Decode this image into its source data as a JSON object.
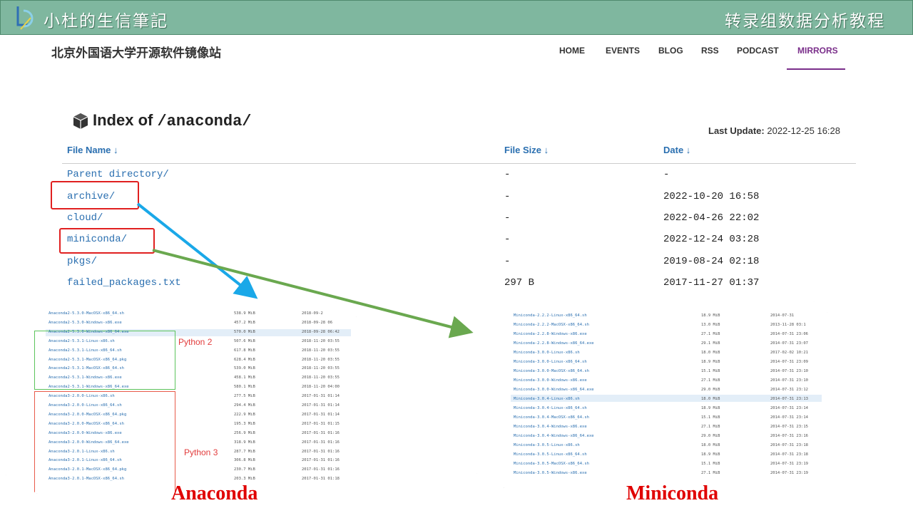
{
  "banner": {
    "left_title": "小杜的生信筆記",
    "right_title": "转录组数据分析教程"
  },
  "site": {
    "name": "北京外国语大学开源软件镜像站",
    "nav": [
      "HOME",
      "EVENTS",
      "BLOG",
      "RSS",
      "PODCAST",
      "MIRRORS"
    ],
    "active_nav": "MIRRORS"
  },
  "index": {
    "title_prefix": "Index of",
    "path": "/anaconda/",
    "last_update_label": "Last Update:",
    "last_update_value": "2022-12-25 16:28",
    "headers": {
      "name": "File Name ↓",
      "size": "File Size ↓",
      "date": "Date ↓"
    },
    "rows": [
      {
        "name": "Parent directory/",
        "size": "-",
        "date": "-"
      },
      {
        "name": "archive/",
        "size": "-",
        "date": "2022-10-20 16:58"
      },
      {
        "name": "cloud/",
        "size": "-",
        "date": "2022-04-26 22:02"
      },
      {
        "name": "miniconda/",
        "size": "-",
        "date": "2022-12-24 03:28"
      },
      {
        "name": "pkgs/",
        "size": "-",
        "date": "2019-08-24 02:18"
      },
      {
        "name": "failed_packages.txt",
        "size": "297 B",
        "date": "2017-11-27 01:37"
      }
    ]
  },
  "anaconda_shot": {
    "caption": "Anaconda",
    "label_py2": "Python 2",
    "label_py3": "Python 3",
    "rows": [
      {
        "name": "Anaconda2-5.3.0-MacOSX-x86_64.sh",
        "size": "538.9 MiB",
        "date": "2018-09-2"
      },
      {
        "name": "Anaconda2-5.3.0-Windows-x86.exe",
        "size": "457.2 MiB",
        "date": "2018-09-28 06"
      },
      {
        "name": "Anaconda2-5.3.0-Windows-x86_64.exe",
        "size": "570.0 MiB",
        "date": "2018-09-28 06:42"
      },
      {
        "name": "Anaconda2-5.3.1-Linux-x86.sh",
        "size": "507.6 MiB",
        "date": "2018-11-20 03:55"
      },
      {
        "name": "Anaconda2-5.3.1-Linux-x86_64.sh",
        "size": "617.8 MiB",
        "date": "2018-11-20 03:55"
      },
      {
        "name": "Anaconda2-5.3.1-MacOSX-x86_64.pkg",
        "size": "628.4 MiB",
        "date": "2018-11-20 03:55"
      },
      {
        "name": "Anaconda2-5.3.1-MacOSX-x86_64.sh",
        "size": "539.0 MiB",
        "date": "2018-11-20 03:55"
      },
      {
        "name": "Anaconda2-5.3.1-Windows-x86.exe",
        "size": "458.1 MiB",
        "date": "2018-11-20 03:55"
      },
      {
        "name": "Anaconda2-5.3.1-Windows-x86_64.exe",
        "size": "580.1 MiB",
        "date": "2018-11-20 04:00"
      },
      {
        "name": "Anaconda3-2.0.0-Linux-x86.sh",
        "size": "277.5 MiB",
        "date": "2017-01-31 01:14"
      },
      {
        "name": "Anaconda3-2.0.0-Linux-x86_64.sh",
        "size": "294.4 MiB",
        "date": "2017-01-31 01:14"
      },
      {
        "name": "Anaconda3-2.0.0-MacOSX-x86_64.pkg",
        "size": "222.9 MiB",
        "date": "2017-01-31 01:14"
      },
      {
        "name": "Anaconda3-2.0.0-MacOSX-x86_64.sh",
        "size": "195.3 MiB",
        "date": "2017-01-31 01:15"
      },
      {
        "name": "Anaconda3-2.0.0-Windows-x86.exe",
        "size": "256.9 MiB",
        "date": "2017-01-31 01:16"
      },
      {
        "name": "Anaconda3-2.0.0-Windows-x86_64.exe",
        "size": "318.9 MiB",
        "date": "2017-01-31 01:16"
      },
      {
        "name": "Anaconda3-2.0.1-Linux-x86.sh",
        "size": "287.7 MiB",
        "date": "2017-01-31 01:16"
      },
      {
        "name": "Anaconda3-2.0.1-Linux-x86_64.sh",
        "size": "306.8 MiB",
        "date": "2017-01-31 01:16"
      },
      {
        "name": "Anaconda3-2.0.1-MacOSX-x86_64.pkg",
        "size": "230.7 MiB",
        "date": "2017-01-31 01:16"
      },
      {
        "name": "Anaconda3-2.0.1-MacOSX-x86_64.sh",
        "size": "203.3 MiB",
        "date": "2017-01-31 01:18"
      }
    ]
  },
  "miniconda_shot": {
    "caption": "Miniconda",
    "rows": [
      {
        "name": "Miniconda-2.2.2-Linux-x86_64.sh",
        "size": "18.9 MiB",
        "date": "2014-07-31"
      },
      {
        "name": "Miniconda-2.2.2-MacOSX-x86_64.sh",
        "size": "13.0 MiB",
        "date": "2013-11-28 03:1"
      },
      {
        "name": "Miniconda-2.2.8-Windows-x86.exe",
        "size": "27.1 MiB",
        "date": "2014-07-31 23:06"
      },
      {
        "name": "Miniconda-2.2.8-Windows-x86_64.exe",
        "size": "29.1 MiB",
        "date": "2014-07-31 23:07"
      },
      {
        "name": "Miniconda-3.0.0-Linux-x86.sh",
        "size": "18.0 MiB",
        "date": "2017-02-02 10:21"
      },
      {
        "name": "Miniconda-3.0.0-Linux-x86_64.sh",
        "size": "18.9 MiB",
        "date": "2014-07-31 23:09"
      },
      {
        "name": "Miniconda-3.0.0-MacOSX-x86_64.sh",
        "size": "15.1 MiB",
        "date": "2014-07-31 23:10"
      },
      {
        "name": "Miniconda-3.0.0-Windows-x86.exe",
        "size": "27.1 MiB",
        "date": "2014-07-31 23:10"
      },
      {
        "name": "Miniconda-3.0.0-Windows-x86_64.exe",
        "size": "29.0 MiB",
        "date": "2014-07-31 23:12"
      },
      {
        "name": "Miniconda-3.0.4-Linux-x86.sh",
        "size": "18.0 MiB",
        "date": "2014-07-31 23:13"
      },
      {
        "name": "Miniconda-3.0.4-Linux-x86_64.sh",
        "size": "18.9 MiB",
        "date": "2014-07-31 23:14"
      },
      {
        "name": "Miniconda-3.0.4-MacOSX-x86_64.sh",
        "size": "15.1 MiB",
        "date": "2014-07-31 23:14"
      },
      {
        "name": "Miniconda-3.0.4-Windows-x86.exe",
        "size": "27.1 MiB",
        "date": "2014-07-31 23:15"
      },
      {
        "name": "Miniconda-3.0.4-Windows-x86_64.exe",
        "size": "29.0 MiB",
        "date": "2014-07-31 23:16"
      },
      {
        "name": "Miniconda-3.0.5-Linux-x86.sh",
        "size": "18.0 MiB",
        "date": "2014-07-31 23:18"
      },
      {
        "name": "Miniconda-3.0.5-Linux-x86_64.sh",
        "size": "18.9 MiB",
        "date": "2014-07-31 23:18"
      },
      {
        "name": "Miniconda-3.0.5-MacOSX-x86_64.sh",
        "size": "15.1 MiB",
        "date": "2014-07-31 23:19"
      },
      {
        "name": "Miniconda-3.0.5-Windows-x86.exe",
        "size": "27.1 MiB",
        "date": "2014-07-31 23:19"
      }
    ]
  }
}
